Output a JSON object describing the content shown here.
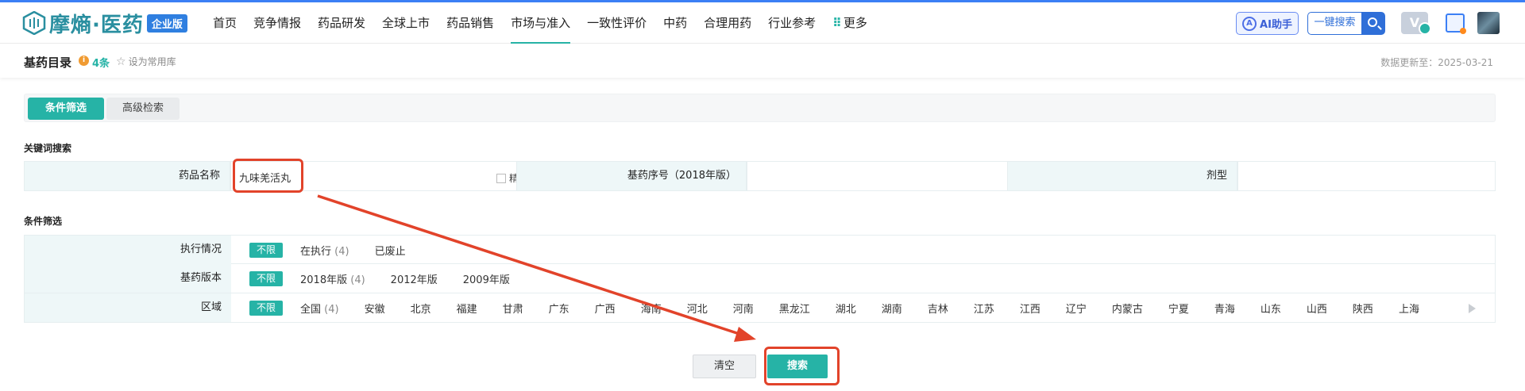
{
  "brand": {
    "name": "摩熵·医药",
    "badge": "企业版",
    "color": "#2a8fa0",
    "accent": "#26b3a6"
  },
  "nav": {
    "items": [
      "首页",
      "竞争情报",
      "药品研发",
      "全球上市",
      "药品销售",
      "市场与准入",
      "一致性评价",
      "中药",
      "合理用药",
      "行业参考"
    ],
    "more": "更多",
    "active": "市场与准入"
  },
  "header_tools": {
    "ai_label": "AI助手",
    "search_label": "一键搜索"
  },
  "subheader": {
    "title": "基药目录",
    "count": "4条",
    "favorite": "设为常用库",
    "update_time": "数据更新至：2025-03-21"
  },
  "tabs": {
    "active": "条件筛选",
    "inactive": "高级检索"
  },
  "keyword_section": {
    "title": "关键词搜索",
    "drug_name_label": "药品名称",
    "drug_name_value": "九味羌活丸",
    "precise_label": "精确",
    "serial_label": "基药序号（2018年版）",
    "serial_value": "",
    "dosage_label": "剂型",
    "dosage_value": ""
  },
  "filter_section": {
    "title": "条件筛选",
    "all_label": "不限",
    "rows": [
      {
        "label": "执行情况",
        "options": [
          {
            "text": "在执行",
            "num": "(4)"
          },
          {
            "text": "已废止",
            "num": ""
          }
        ]
      },
      {
        "label": "基药版本",
        "options": [
          {
            "text": "2018年版",
            "num": "(4)"
          },
          {
            "text": "2012年版",
            "num": ""
          },
          {
            "text": "2009年版",
            "num": ""
          }
        ]
      },
      {
        "label": "区域",
        "options": [
          {
            "text": "全国",
            "num": "(4)"
          },
          {
            "text": "安徽",
            "num": ""
          },
          {
            "text": "北京",
            "num": ""
          },
          {
            "text": "福建",
            "num": ""
          },
          {
            "text": "甘肃",
            "num": ""
          },
          {
            "text": "广东",
            "num": ""
          },
          {
            "text": "广西",
            "num": ""
          },
          {
            "text": "海南",
            "num": ""
          },
          {
            "text": "河北",
            "num": ""
          },
          {
            "text": "河南",
            "num": ""
          },
          {
            "text": "黑龙江",
            "num": ""
          },
          {
            "text": "湖北",
            "num": ""
          },
          {
            "text": "湖南",
            "num": ""
          },
          {
            "text": "吉林",
            "num": ""
          },
          {
            "text": "江苏",
            "num": ""
          },
          {
            "text": "江西",
            "num": ""
          },
          {
            "text": "辽宁",
            "num": ""
          },
          {
            "text": "内蒙古",
            "num": ""
          },
          {
            "text": "宁夏",
            "num": ""
          },
          {
            "text": "青海",
            "num": ""
          },
          {
            "text": "山东",
            "num": ""
          },
          {
            "text": "山西",
            "num": ""
          },
          {
            "text": "陕西",
            "num": ""
          },
          {
            "text": "上海",
            "num": ""
          }
        ]
      }
    ]
  },
  "actions": {
    "clear": "清空",
    "search": "搜索"
  },
  "annotation": {
    "color": "#e2432a"
  }
}
